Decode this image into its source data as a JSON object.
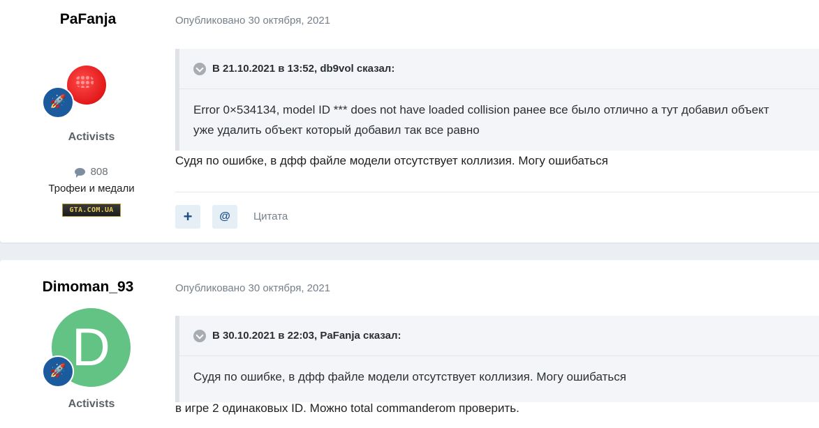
{
  "posts": [
    {
      "author": "PaFanja",
      "group": "Activists",
      "post_count": "808",
      "trophies_label": "Трофеи и медали",
      "medal_text": "GTA.COM.UA",
      "date": "Опубликовано 30 октября, 2021",
      "quote_header": "В 21.10.2021 в 13:52, db9vol сказал:",
      "quote_lines": [
        "Error 0×534134, model ID *** does not have loaded collision ранее все было отлично а тут добавил объект",
        "уже удалить объект который добавил так все равно"
      ],
      "reply": "Судя по ошибке, в дфф файле модели отсутствует коллизия. Могу ошибаться",
      "actions": {
        "plus": "+",
        "mention": "@",
        "quote": "Цитата"
      }
    },
    {
      "author": "Dimoman_93",
      "avatar_letter": "D",
      "group": "Activists",
      "date": "Опубликовано 30 октября, 2021",
      "quote_header": "В 30.10.2021 в 22:03, PaFanja сказал:",
      "quote_lines": [
        "Судя по ошибке, в дфф файле модели отсутствует коллизия. Могу ошибаться"
      ],
      "reply": "в игре 2 одинаковых ID. Можно total commanderom проверить."
    }
  ],
  "colors": {
    "badge": "#1b5a9c",
    "avatar_green": "#62c384",
    "avatar_red": "#e41c1c"
  },
  "icons": {
    "rank": "rocket-icon",
    "comment": "comment-icon",
    "quote_toggle": "chevron-down-icon"
  }
}
